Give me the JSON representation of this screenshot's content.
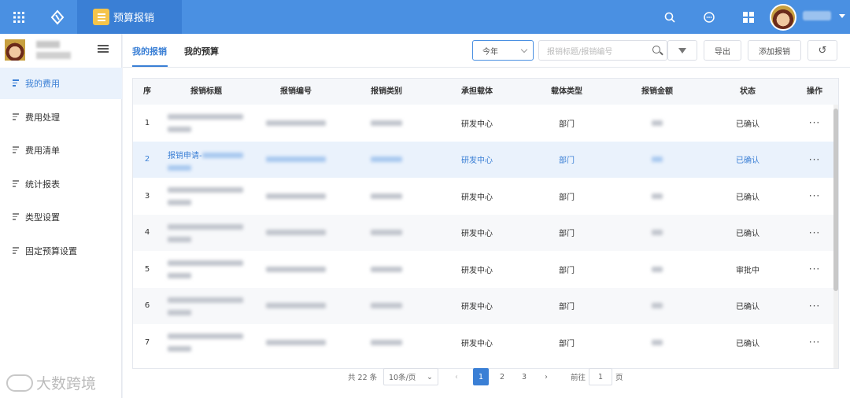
{
  "topbar": {
    "app_title": "预算报销",
    "icons": [
      "apps-grid-icon",
      "logo-icon",
      "search-icon",
      "chat-icon",
      "windows-icon",
      "avatar",
      "caret-down-icon"
    ]
  },
  "sidebar": {
    "items": [
      {
        "label": "我的费用",
        "active": true
      },
      {
        "label": "费用处理"
      },
      {
        "label": "费用清单"
      },
      {
        "label": "统计报表"
      },
      {
        "label": "类型设置"
      },
      {
        "label": "固定预算设置"
      }
    ]
  },
  "watermark": "大数跨境",
  "tabs": [
    {
      "label": "我的报销",
      "active": true
    },
    {
      "label": "我的预算"
    }
  ],
  "toolbar": {
    "year": "今年",
    "search_placeholder": "报销标题/报销编号",
    "export": "导出",
    "add": "添加报销"
  },
  "table": {
    "headers": [
      "序",
      "报销标题",
      "报销编号",
      "报销类别",
      "承担载体",
      "载体类型",
      "报销金额",
      "状态",
      "操作"
    ],
    "rows": [
      {
        "no": "1",
        "title_prefix": "",
        "carrier": "研发中心",
        "carrier_type": "部门",
        "status": "已确认",
        "action": "···"
      },
      {
        "no": "2",
        "title_prefix": "报销申请-",
        "carrier": "研发中心",
        "carrier_type": "部门",
        "status": "已确认",
        "action": "···",
        "selected": true
      },
      {
        "no": "3",
        "title_prefix": "",
        "carrier": "研发中心",
        "carrier_type": "部门",
        "status": "已确认",
        "action": "···"
      },
      {
        "no": "4",
        "title_prefix": "",
        "carrier": "研发中心",
        "carrier_type": "部门",
        "status": "已确认",
        "action": "···"
      },
      {
        "no": "5",
        "title_prefix": "",
        "carrier": "研发中心",
        "carrier_type": "部门",
        "status": "审批中",
        "action": "···"
      },
      {
        "no": "6",
        "title_prefix": "",
        "carrier": "研发中心",
        "carrier_type": "部门",
        "status": "已确认",
        "action": "···"
      },
      {
        "no": "7",
        "title_prefix": "",
        "carrier": "研发中心",
        "carrier_type": "部门",
        "status": "已确认",
        "action": "···"
      }
    ]
  },
  "pagination": {
    "total": "共 22 条",
    "page_size": "10条/页",
    "pages": [
      "1",
      "2",
      "3"
    ],
    "current": "1",
    "goto_label": "前往",
    "goto_value": "1",
    "page_suffix": "页"
  },
  "colors": {
    "primary": "#4a90e2",
    "accent": "#3a7fd5",
    "sidebar_active_bg": "#eaf2fc"
  }
}
